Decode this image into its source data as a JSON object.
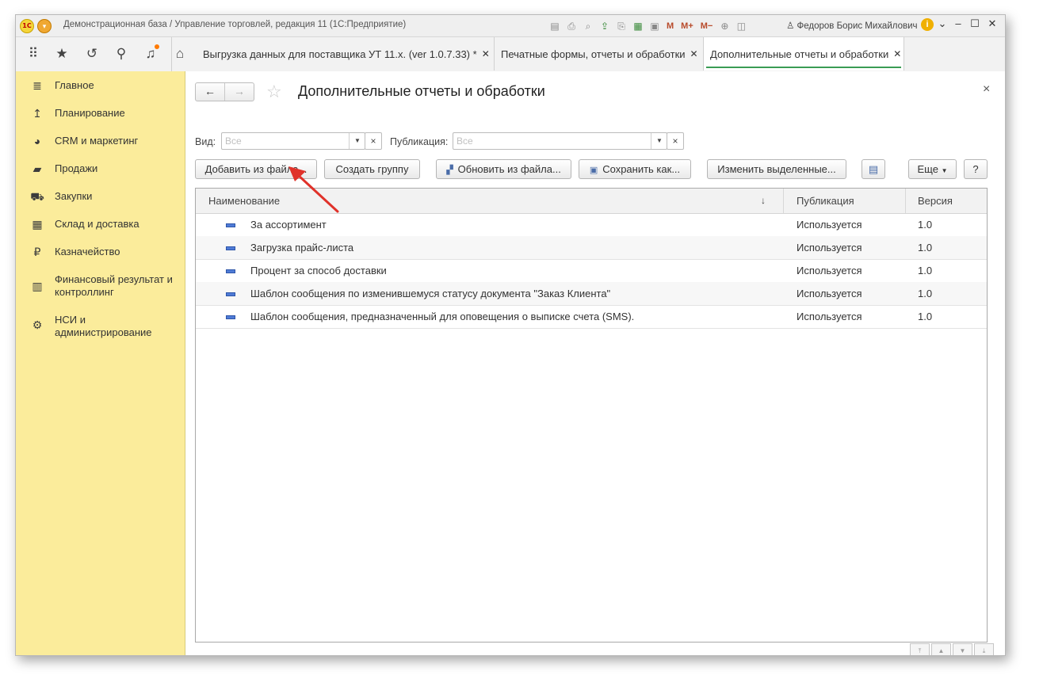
{
  "window": {
    "title": "Демонстрационная база / Управление торговлей, редакция 11  (1С:Предприятие)",
    "logo_text": "1С",
    "user": "Федоров Борис Михайлович",
    "toolbar_icons": [
      "save-icon",
      "print-icon",
      "preview-icon",
      "upload-icon",
      "print-preview-icon",
      "calculator-icon",
      "calendar-icon"
    ],
    "memory_buttons": [
      "M",
      "M+",
      "M−"
    ]
  },
  "nav_icons": [
    "apps-grid-icon",
    "favorites-star-icon",
    "history-icon",
    "search-icon",
    "notifications-bell-icon",
    "home-icon"
  ],
  "tabs": [
    {
      "label": "Выгрузка данных для поставщика УТ 11.x. (ver 1.0.7.33) *",
      "active": false
    },
    {
      "label": "Печатные формы, отчеты и обработки",
      "active": false
    },
    {
      "label": "Дополнительные отчеты и обработки",
      "active": true
    }
  ],
  "sidebar": {
    "items": [
      {
        "label": "Главное",
        "icon": "menu-lines-icon"
      },
      {
        "label": "Планирование",
        "icon": "planning-icon"
      },
      {
        "label": "CRM и маркетинг",
        "icon": "pie-chart-icon"
      },
      {
        "label": "Продажи",
        "icon": "shopping-bag-icon"
      },
      {
        "label": "Закупки",
        "icon": "cart-icon"
      },
      {
        "label": "Склад и доставка",
        "icon": "warehouse-icon"
      },
      {
        "label": "Казначейство",
        "icon": "ruble-icon"
      },
      {
        "label": "Финансовый результат и контроллинг",
        "icon": "bar-chart-icon"
      },
      {
        "label": "НСИ и администрирование",
        "icon": "gear-icon"
      }
    ]
  },
  "page": {
    "title": "Дополнительные отчеты и обработки",
    "filters": {
      "vid_label": "Вид:",
      "vid_placeholder": "Все",
      "pub_label": "Публикация:",
      "pub_placeholder": "Все"
    },
    "buttons": {
      "add_from_file": "Добавить из файла...",
      "create_group": "Создать группу",
      "update_from_file": "Обновить из файла...",
      "save_as": "Сохранить как...",
      "change_selected": "Изменить выделенные...",
      "more": "Еще",
      "help": "?"
    },
    "table": {
      "columns": {
        "name": "Наименование",
        "publication": "Публикация",
        "version": "Версия"
      },
      "rows": [
        {
          "name": "За ассортимент",
          "publication": "Используется",
          "version": "1.0"
        },
        {
          "name": "Загрузка прайс-листа",
          "publication": "Используется",
          "version": "1.0"
        },
        {
          "name": "Процент за способ доставки",
          "publication": "Используется",
          "version": "1.0"
        },
        {
          "name": "Шаблон сообщения по изменившемуся статусу документа \"Заказ Клиента\"",
          "publication": "Используется",
          "version": "1.0"
        },
        {
          "name": "Шаблон сообщения, предназначенный для оповещения о выписке счета (SMS).",
          "publication": "Используется",
          "version": "1.0"
        }
      ]
    }
  },
  "colors": {
    "sidebar_bg": "#fbec9b",
    "active_tab_underline": "#3a9c54",
    "annotation_arrow": "#e0322a"
  }
}
